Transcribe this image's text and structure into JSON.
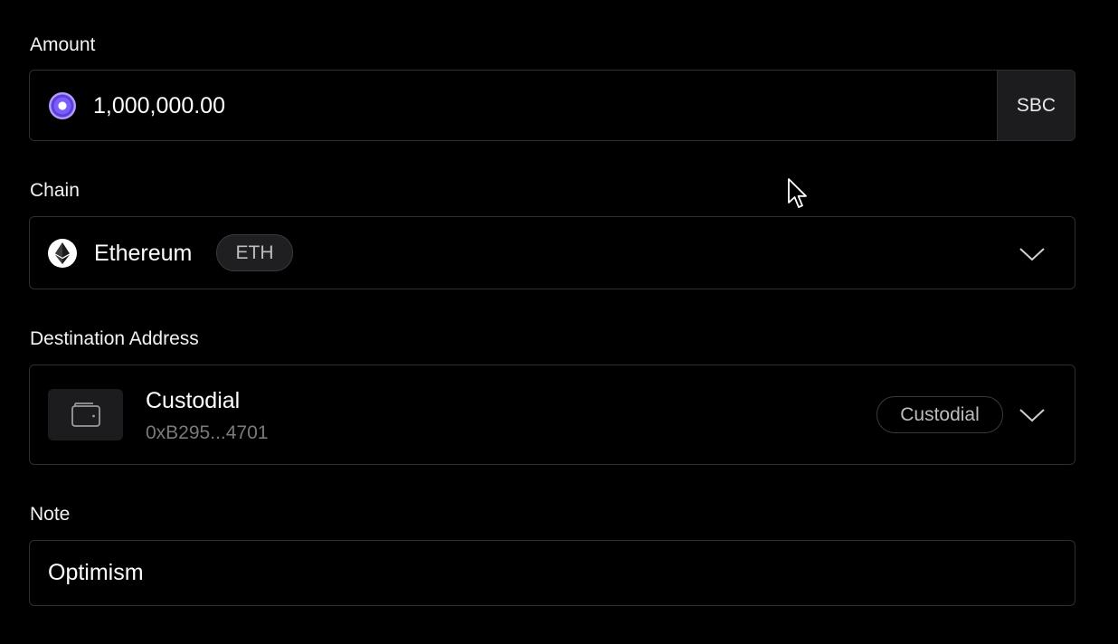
{
  "amount": {
    "label": "Amount",
    "value": "1,000,000.00",
    "currency": "SBC",
    "token_icon": "sbc-token-icon"
  },
  "chain": {
    "label": "Chain",
    "name": "Ethereum",
    "ticker": "ETH",
    "icon": "ethereum-icon"
  },
  "destination": {
    "label": "Destination Address",
    "name": "Custodial",
    "address": "0xB295...4701",
    "badge": "Custodial",
    "icon": "wallet-icon"
  },
  "note": {
    "label": "Note",
    "value": "Optimism"
  },
  "colors": {
    "background": "#000000",
    "border": "#2e2e2e",
    "muted_text": "#7a7a7a",
    "token_accent": "#7b5cff"
  }
}
